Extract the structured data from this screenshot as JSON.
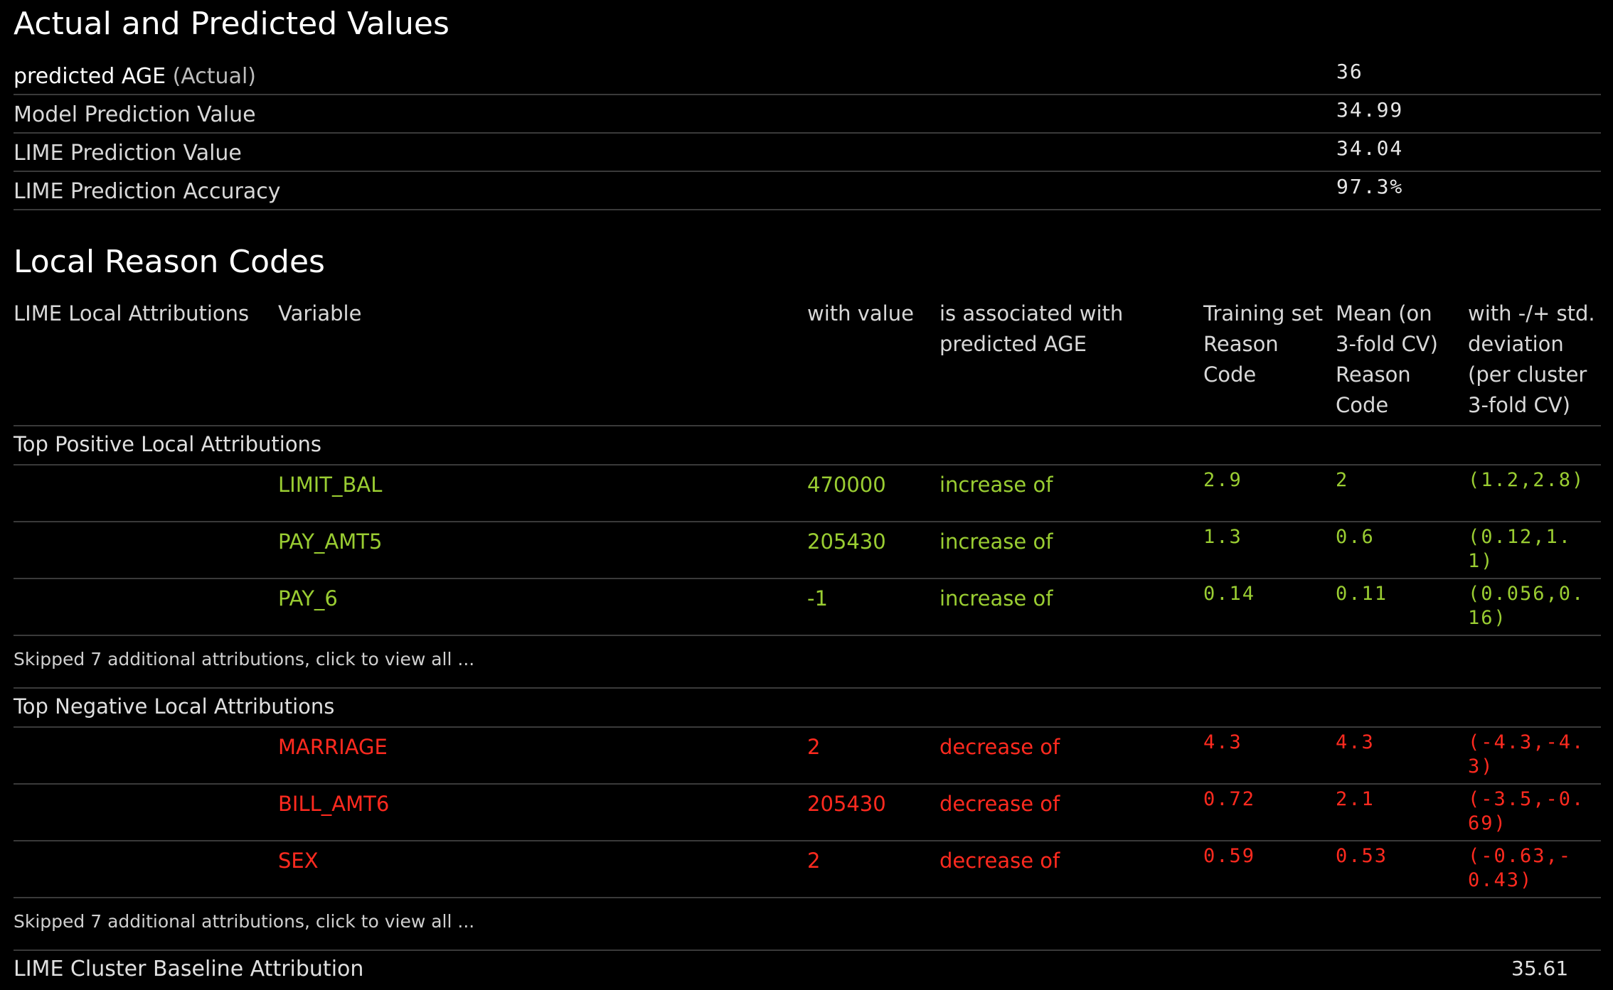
{
  "actual_section": {
    "title": "Actual and Predicted Values",
    "rows": [
      {
        "label": "predicted AGE",
        "label_suffix": "(Actual)",
        "value": "36"
      },
      {
        "label": "Model Prediction Value",
        "value": "34.99"
      },
      {
        "label": "LIME Prediction Value",
        "value": "34.04"
      },
      {
        "label": "LIME Prediction Accuracy",
        "value": "97.3%"
      }
    ]
  },
  "reason_codes": {
    "title": "Local Reason Codes",
    "headers": {
      "attributions": "LIME Local Attributions",
      "variable": "Variable",
      "with_value": "with value",
      "associated": "is associated with predicted AGE",
      "training": "Training set Reason Code",
      "mean": "Mean (on 3-fold CV) Reason Code",
      "std": "with -/+ std. deviation (per cluster 3-fold CV)"
    },
    "positive": {
      "title": "Top Positive Local Attributions",
      "rows": [
        {
          "variable": "LIMIT_BAL",
          "value": "470000",
          "assoc": "increase of",
          "training": "2.9",
          "mean": "2",
          "std": "(1.2,2.8)"
        },
        {
          "variable": "PAY_AMT5",
          "value": "205430",
          "assoc": "increase of",
          "training": "1.3",
          "mean": "0.6",
          "std": "(0.12,1.1)"
        },
        {
          "variable": "PAY_6",
          "value": "-1",
          "assoc": "increase of",
          "training": "0.14",
          "mean": "0.11",
          "std": "(0.056,0.16)"
        }
      ],
      "skipped": "Skipped 7 additional attributions, click to view all ..."
    },
    "negative": {
      "title": "Top Negative Local Attributions",
      "rows": [
        {
          "variable": "MARRIAGE",
          "value": "2",
          "assoc": "decrease of",
          "training": "4.3",
          "mean": "4.3",
          "std": "(-4.3,-4.3)"
        },
        {
          "variable": "BILL_AMT6",
          "value": "205430",
          "assoc": "decrease of",
          "training": "0.72",
          "mean": "2.1",
          "std": "(-3.5,-0.69)"
        },
        {
          "variable": "SEX",
          "value": "2",
          "assoc": "decrease of",
          "training": "0.59",
          "mean": "0.53",
          "std": "(-0.63,-0.43)"
        }
      ],
      "skipped": "Skipped 7 additional attributions, click to view all ..."
    },
    "baseline": {
      "label": "LIME Cluster Baseline Attribution",
      "value": "35.61"
    }
  },
  "colors": {
    "positive": "#9acd32",
    "negative": "#ff2a1f",
    "background": "#000000"
  }
}
